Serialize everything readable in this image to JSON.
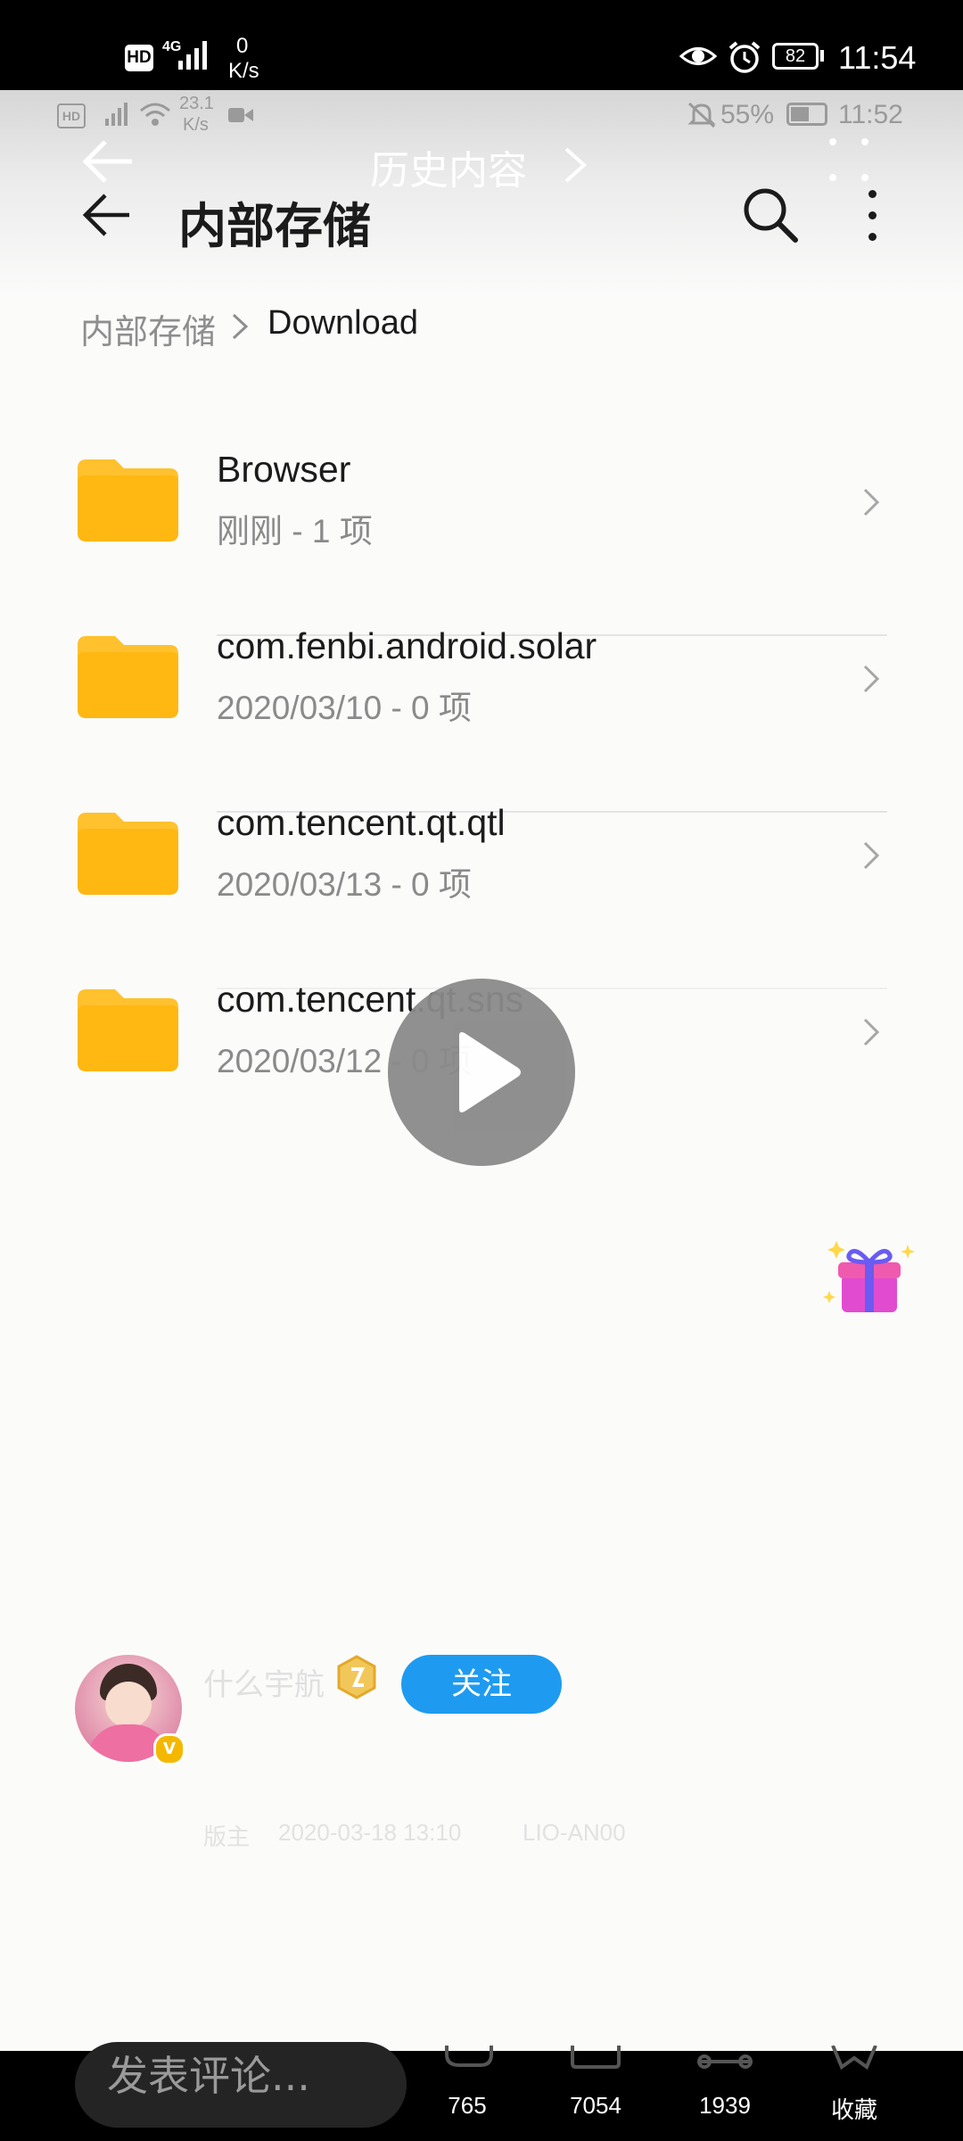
{
  "outer_status": {
    "hd": "HD",
    "net": "4G",
    "speed_value": "0",
    "speed_unit": "K/s",
    "battery": "82",
    "time": "11:54"
  },
  "inner_status": {
    "speed_value": "23.1",
    "speed_unit": "K/s",
    "battery_pct": "55%",
    "time": "11:52"
  },
  "overlay_title": "历史内容",
  "header": {
    "title": "内部存储"
  },
  "breadcrumb": {
    "root": "内部存储",
    "current": "Download"
  },
  "files": [
    {
      "name": "Browser",
      "meta": "刚刚 - 1 项"
    },
    {
      "name": "com.fenbi.android.solar",
      "meta": "2020/03/10 - 0 项"
    },
    {
      "name": "com.tencent.qt.qtl",
      "meta": "2020/03/13 - 0 项"
    },
    {
      "name": "com.tencent.qt.sns",
      "meta": "2020/03/12 - 0 项"
    }
  ],
  "author": {
    "name": "什么宇航",
    "role": "版主",
    "datetime": "2020-03-18 13:10",
    "device": "LIO-AN00",
    "follow_label": "关注"
  },
  "bottom_bar": {
    "comment_placeholder": "发表评论...",
    "comments_count": "765",
    "share_count": "7054",
    "forward_count": "1939",
    "favorite_label": "收藏"
  },
  "colors": {
    "folder": "#FFC12E",
    "follow": "#1E9BF0",
    "play_button": "#8a8a8a"
  }
}
